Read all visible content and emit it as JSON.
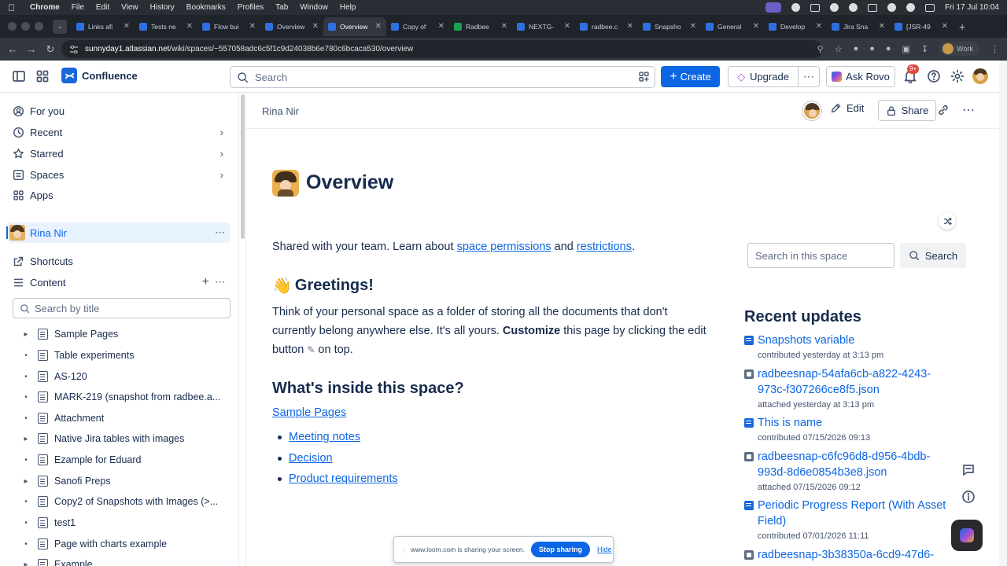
{
  "menubar": {
    "app": "Chrome",
    "items": [
      "File",
      "Edit",
      "View",
      "History",
      "Bookmarks",
      "Profiles",
      "Tab",
      "Window",
      "Help"
    ],
    "clock": "Fri 17 Jul  10:04"
  },
  "tabs": [
    {
      "label": "Links afi"
    },
    {
      "label": "Tests ne"
    },
    {
      "label": "Flow bui"
    },
    {
      "label": "Overview"
    },
    {
      "label": "Overview",
      "active": true
    },
    {
      "label": "Copy of"
    },
    {
      "label": "Radbee"
    },
    {
      "label": "NEXTG-"
    },
    {
      "label": "radbee.c"
    },
    {
      "label": "Snapsho"
    },
    {
      "label": "General"
    },
    {
      "label": "Develop"
    },
    {
      "label": "Jira Sna"
    },
    {
      "label": "[JSR-49"
    }
  ],
  "address": {
    "host": "sunnyday1.atlassian.net",
    "path": "/wiki/spaces/~557058adc6c5f1c9d24038b6e780c6bcaca530/overview",
    "profile_label": "Work"
  },
  "topnav": {
    "product": "Confluence",
    "search_placeholder": "Search",
    "create_label": "Create",
    "upgrade_label": "Upgrade",
    "rovo_label": "Ask Rovo",
    "notif_badge": "9+"
  },
  "sidebar": {
    "nav": [
      {
        "label": "For you",
        "icon": "user-icon",
        "chevron": false
      },
      {
        "label": "Recent",
        "icon": "clock-icon",
        "chevron": true
      },
      {
        "label": "Starred",
        "icon": "star-icon",
        "chevron": true
      },
      {
        "label": "Spaces",
        "icon": "spaces-icon",
        "chevron": true
      },
      {
        "label": "Apps",
        "icon": "apps-icon",
        "chevron": false
      }
    ],
    "space_name": "Rina Nir",
    "shortcuts_label": "Shortcuts",
    "content_label": "Content",
    "title_search_placeholder": "Search by title",
    "tree": [
      {
        "label": "Sample Pages",
        "expandable": true
      },
      {
        "label": "Table experiments",
        "expandable": false
      },
      {
        "label": "AS-120",
        "expandable": false
      },
      {
        "label": "MARK-219 (snapshot from radbee.a...",
        "expandable": false
      },
      {
        "label": "Attachment",
        "expandable": false
      },
      {
        "label": "Native Jira tables with images",
        "expandable": true
      },
      {
        "label": "Ezample for Eduard",
        "expandable": false
      },
      {
        "label": "Sanofi Preps",
        "expandable": true
      },
      {
        "label": "Copy2 of Snapshots with Images (>...",
        "expandable": false
      },
      {
        "label": "test1",
        "expandable": false
      },
      {
        "label": "Page with charts example",
        "expandable": false
      },
      {
        "label": "Example",
        "expandable": true
      }
    ]
  },
  "page": {
    "author": "Rina Nir",
    "edit_label": "Edit",
    "share_label": "Share",
    "title": "Overview",
    "intro_prefix": "Shared with your team. Learn about ",
    "intro_link1": "space permissions",
    "intro_mid": " and ",
    "intro_link2": "restrictions",
    "intro_suffix": ".",
    "greeting_emoji": "👋",
    "greeting": "Greetings!",
    "para_a": "Think of your personal space as a folder of storing all the documents that don't currently belong anywhere else. It's all yours. ",
    "para_bold": "Customize",
    "para_b": " this page by clicking the edit button ",
    "para_c": " on top.",
    "inside_heading": "What's inside this space?",
    "sample_link": "Sample Pages",
    "bullets": [
      "Meeting notes",
      "Decision",
      "Product requirements"
    ]
  },
  "right": {
    "search_placeholder": "Search in this space",
    "search_button": "Search",
    "recent_title": "Recent updates",
    "updates": [
      {
        "title": "Snapshots variable",
        "type": "page",
        "meta": "contributed yesterday at 3:13 pm"
      },
      {
        "title": "radbeesnap-54afa6cb-a822-4243-973c-f307266ce8f5.json",
        "type": "file",
        "meta": "attached yesterday at 3:13 pm"
      },
      {
        "title": "This is name",
        "type": "page",
        "meta": "contributed 07/15/2026 09:13"
      },
      {
        "title": "radbeesnap-c6fc96d8-d956-4bdb-993d-8d6e0854b3e8.json",
        "type": "file",
        "meta": "attached 07/15/2026 09:12"
      },
      {
        "title": "Periodic Progress Report (With Asset Field)",
        "type": "page",
        "meta": "contributed 07/01/2026 11:11"
      },
      {
        "title": "radbeesnap-3b38350a-6cd9-47d6-",
        "type": "file",
        "meta": ""
      }
    ]
  },
  "loom": {
    "message": "www.loom.com is sharing your screen.",
    "stop_label": "Stop sharing",
    "hide_label": "Hide"
  },
  "colors": {
    "accent": "#0c66e4",
    "create_bg": "#0c66e4",
    "badge": "#e2483d"
  }
}
